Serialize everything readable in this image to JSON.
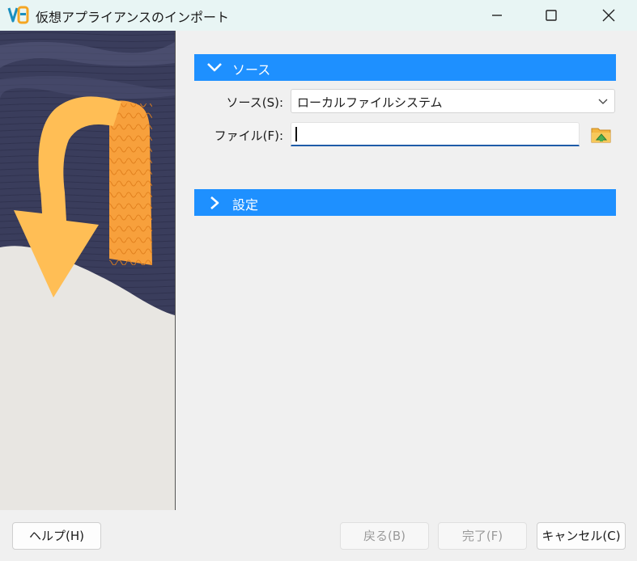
{
  "window": {
    "title": "仮想アプライアンスのインポート"
  },
  "sections": {
    "source": {
      "label": "ソース",
      "expanded": true
    },
    "settings": {
      "label": "設定",
      "expanded": false
    }
  },
  "source_form": {
    "source_label": "ソース(S):",
    "source_value": "ローカルファイルシステム",
    "file_label": "ファイル(F):",
    "file_value": ""
  },
  "footer": {
    "help_label": "ヘルプ(H)",
    "back_label": "戻る(B)",
    "finish_label": "完了(F)",
    "cancel_label": "キャンセル(C)"
  },
  "colors": {
    "section_header": "#1e90ff",
    "arrow": "#ffbe55",
    "ribbon": "#f7a03c",
    "sidebar_dark": "#3a3d5c",
    "sidebar_light": "#e8e6e2"
  }
}
